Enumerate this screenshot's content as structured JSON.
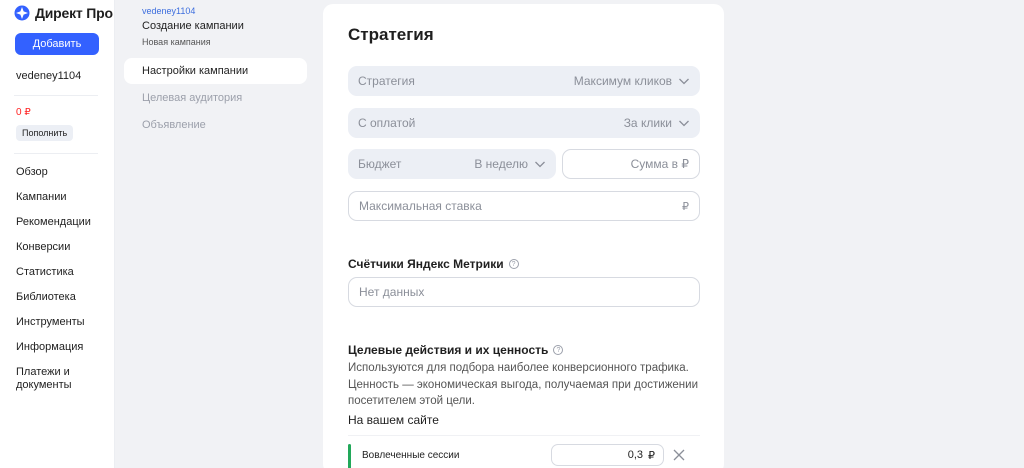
{
  "app": {
    "logo_text": "Директ Про",
    "add_label": "Добавить"
  },
  "sidebar": {
    "user": "vedeney1104",
    "balance": "0 ₽",
    "topup_label": "Пополнить",
    "nav": [
      "Обзор",
      "Кампании",
      "Рекомендации",
      "Конверсии",
      "Статистика",
      "Библиотека",
      "Инструменты",
      "Информация",
      "Платежи и документы"
    ]
  },
  "steps": {
    "login": "vedeney1104",
    "title": "Создание кампании",
    "subtitle": "Новая кампания",
    "items": [
      "Настройки кампании",
      "Целевая аудитория",
      "Объявление"
    ]
  },
  "main": {
    "strategy_title": "Стратегия",
    "strategy": {
      "label": "Стратегия",
      "value": "Максимум кликов"
    },
    "payment": {
      "label": "С оплатой",
      "value": "За клики"
    },
    "budget": {
      "label": "Бюджет",
      "value": "В неделю"
    },
    "sum_placeholder": "Сумма в ₽",
    "max_bid": {
      "label": "Максимальная ставка",
      "currency": "₽"
    },
    "metrika_title": "Счётчики Яндекс Метрики",
    "metrika_placeholder": "Нет данных",
    "goals_title": "Целевые действия и их ценность",
    "goals_desc": "Используются для подбора наиболее конверсионного трафика. Ценность — экономическая выгода, получаемая при достижении посетителем этой цели.",
    "on_site": "На вашем сайте",
    "goal": {
      "name": "Вовлеченные сессии",
      "value": "0,3",
      "currency": "₽"
    }
  },
  "colors": {
    "accent": "#3361ff",
    "negative": "#ff1f1f",
    "goal": "#22a85a"
  }
}
